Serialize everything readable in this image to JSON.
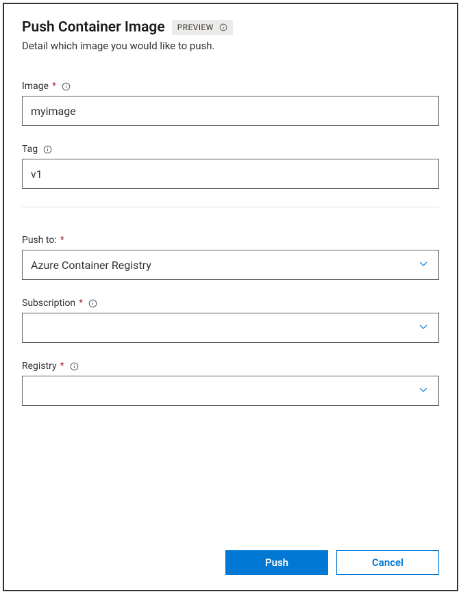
{
  "header": {
    "title": "Push Container Image",
    "badge": "PREVIEW",
    "subtitle": "Detail which image you would like to push."
  },
  "fields": {
    "image": {
      "label": "Image",
      "value": "myimage"
    },
    "tag": {
      "label": "Tag",
      "value": "v1"
    },
    "push_to": {
      "label": "Push to:",
      "value": "Azure Container Registry"
    },
    "subscription": {
      "label": "Subscription",
      "value": ""
    },
    "registry": {
      "label": "Registry",
      "value": ""
    }
  },
  "footer": {
    "primary": "Push",
    "secondary": "Cancel"
  }
}
